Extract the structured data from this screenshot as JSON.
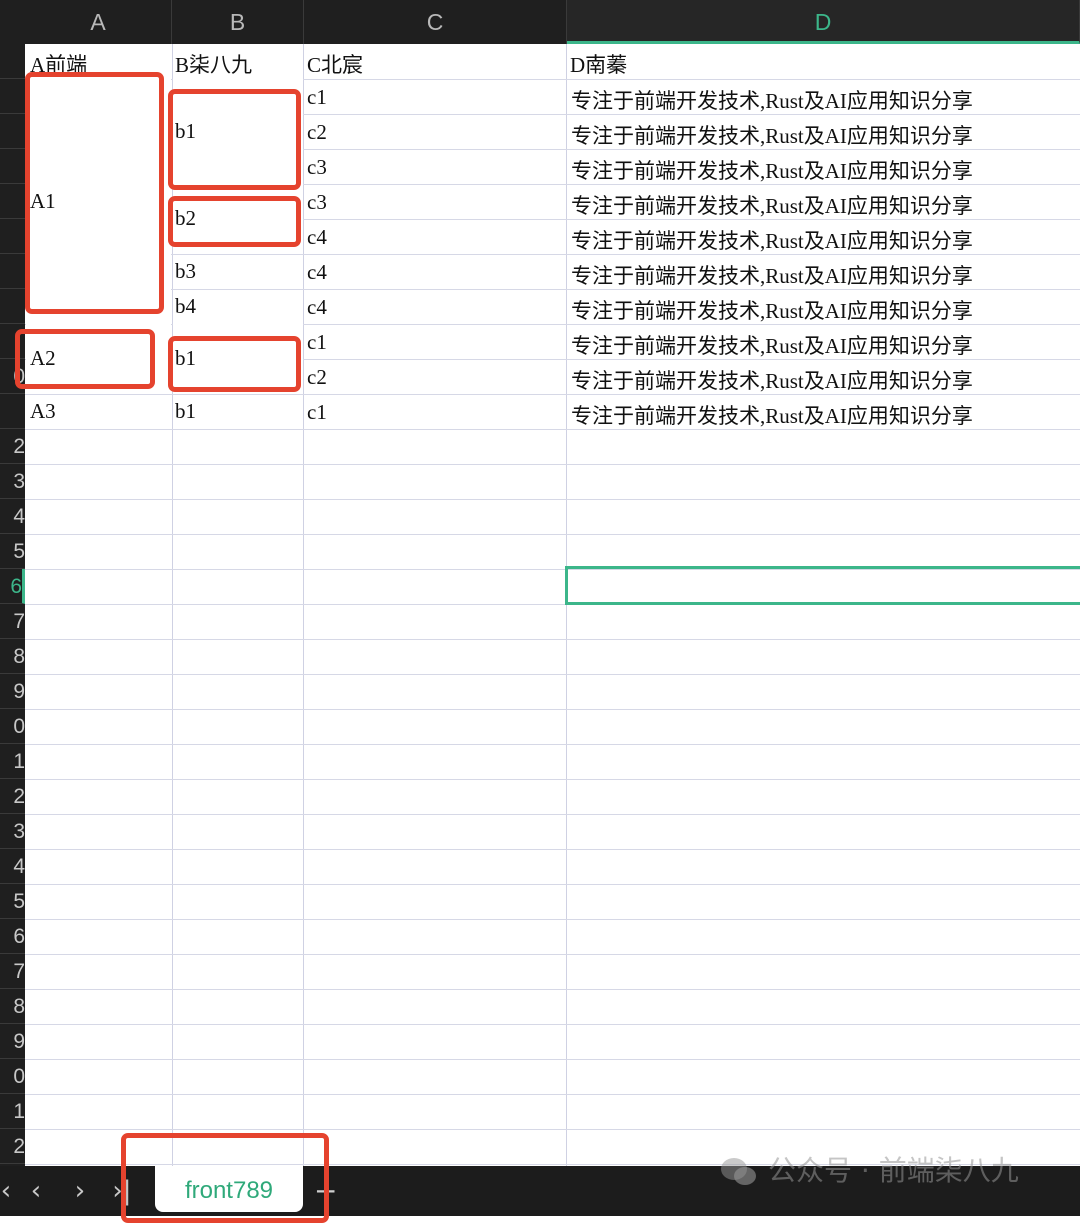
{
  "columns": [
    "A",
    "B",
    "C",
    "D"
  ],
  "active_column": "D",
  "row_numbers": [
    "",
    "",
    "",
    "",
    "",
    "",
    "",
    "",
    "",
    "0",
    "",
    "2",
    "3",
    "4",
    "5",
    "6",
    "7",
    "8",
    "9",
    "0",
    "1",
    "2",
    "3",
    "4",
    "5",
    "6",
    "7",
    "8",
    "9",
    "0",
    "1",
    "2"
  ],
  "active_row_index": 15,
  "header_row": [
    "A前端",
    "B柒八九",
    "C北宸",
    "D南蓁"
  ],
  "merged_col_a": [
    "A1",
    "A2",
    "A3"
  ],
  "merged_col_b": [
    "b1",
    "b2",
    "b3",
    "b4",
    "b1",
    "b1"
  ],
  "col_c": [
    "c1",
    "c2",
    "c3",
    "c3",
    "c4",
    "c4",
    "c4",
    "c1",
    "c2",
    "c1"
  ],
  "col_d": [
    "专注于前端开发技术,Rust及AI应用知识分享",
    "专注于前端开发技术,Rust及AI应用知识分享",
    "专注于前端开发技术,Rust及AI应用知识分享",
    "专注于前端开发技术,Rust及AI应用知识分享",
    "专注于前端开发技术,Rust及AI应用知识分享",
    "专注于前端开发技术,Rust及AI应用知识分享",
    "专注于前端开发技术,Rust及AI应用知识分享",
    "专注于前端开发技术,Rust及AI应用知识分享",
    "专注于前端开发技术,Rust及AI应用知识分享",
    "专注于前端开发技术,Rust及AI应用知识分享"
  ],
  "sheet_nav": {
    "first_icon": "chevron-first-icon",
    "prev_icon": "chevron-left-icon",
    "next_icon": "chevron-right-icon",
    "last_icon": "chevron-last-icon"
  },
  "sheet_tab": "front789",
  "add_sheet_icon": "plus-icon",
  "watermark": "公众号 · 前端柒八九",
  "colors": {
    "accent": "#3cb68a",
    "annotation": "#e5432e",
    "header_bg": "#1f1f1f"
  }
}
